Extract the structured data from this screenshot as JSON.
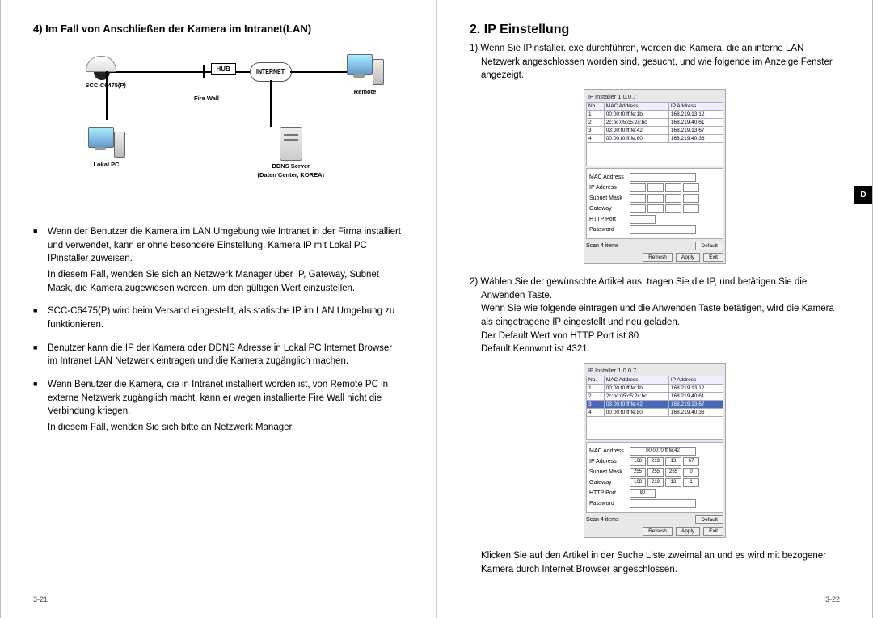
{
  "left": {
    "heading": "4) Im Fall von Anschließen der Kamera im Intranet(LAN)",
    "diagram": {
      "camera": "SCC-C6475(P)",
      "hub": "HUB",
      "firewall": "Fire Wall",
      "internet": "INTERNET",
      "remote": "Remote",
      "local": "Lokal PC",
      "ddns1": "DDNS Server",
      "ddns2": "(Daten Center, KOREA)"
    },
    "bullets": [
      {
        "main": "Wenn der Benutzer die Kamera im LAN Umgebung wie Intranet in der Firma installiert und verwendet, kann er ohne besondere Einstellung, Kamera IP mit Lokal PC IPinstaller zuweisen.",
        "sub": "In diesem Fall, wenden Sie sich an Netzwerk Manager über IP, Gateway, Subnet Mask, die Kamera zugewiesen werden, um den gültigen Wert einzustellen."
      },
      {
        "main": "SCC-C6475(P) wird beim Versand eingestellt, als statische IP im LAN Umgebung zu funktionieren."
      },
      {
        "main": "Benutzer kann die IP der Kamera oder DDNS Adresse in Lokal PC Internet Browser im Intranet LAN Netzwerk eintragen und die Kamera zugänglich machen."
      },
      {
        "main": "Wenn Benutzer die Kamera, die in Intranet installiert worden ist, von Remote PC in externe Netzwerk zugänglich macht, kann er wegen installierte Fire Wall nicht die Verbindung kriegen.",
        "sub": "In diesem Fall, wenden Sie sich bitte an Netzwerk Manager."
      }
    ],
    "pageno": "3-21"
  },
  "right": {
    "heading": "2. IP Einstellung",
    "para1_num": "1)",
    "para1": "Wenn Sie IPinstaller. exe durchführen, werden die Kamera, die an interne LAN Netzwerk angeschlossen worden sind, gesucht, und wie folgende im Anzeige Fenster angezeigt.",
    "installer_title": "IP Installer 1.0.0.7",
    "table": {
      "headers": [
        "No.",
        "MAC Address",
        "IP Address"
      ],
      "rows": [
        [
          "1",
          "00:00:f0:ff:fe:1b",
          "168.219.13.12"
        ],
        [
          "2",
          "2c:bc:05:c5:2c:bc",
          "168.219.40.61"
        ],
        [
          "3",
          "03:00:f0:ff:fe:42",
          "168.219.13.67"
        ],
        [
          "4",
          "00:00:f0:ff:fe:80",
          "168.219.40.36"
        ]
      ]
    },
    "fields": {
      "mac": "MAC Address",
      "ip": "IP Address",
      "subnet": "Subnet Mask",
      "gateway": "Gateway",
      "http": "HTTP Port",
      "password": "Password"
    },
    "scan": "Scan 4 items",
    "buttons": {
      "default": "Default",
      "refresh": "Refresh",
      "apply": "Apply",
      "exit": "Exit"
    },
    "para2_num": "2)",
    "para2_a": "Wählen Sie der gewünschte Artikel aus, tragen Sie die IP, und betätigen Sie die Anwenden Taste.",
    "para2_b": "Wenn Sie wie folgende eintragen und die Anwenden Taste betätigen, wird die Kamera als eingetragene IP eingestellt und neu geladen.",
    "para2_c": "Der Default Wert von HTTP Port ist 80.",
    "para2_d": "Default Kennwort ist 4321.",
    "installer2": {
      "selected_mac": "00:00:f0:ff:fe:42",
      "ip": [
        "168",
        "219",
        "13",
        "67"
      ],
      "subnet": [
        "255",
        "255",
        "255",
        "0"
      ],
      "gateway": [
        "168",
        "219",
        "13",
        "1"
      ],
      "http": "80"
    },
    "footnote": "Klicken Sie auf den Artikel in der Suche Liste zweimal an und es wird mit bezogener Kamera durch Internet Browser angeschlossen.",
    "pageno": "3-22",
    "sidetab": "D"
  }
}
